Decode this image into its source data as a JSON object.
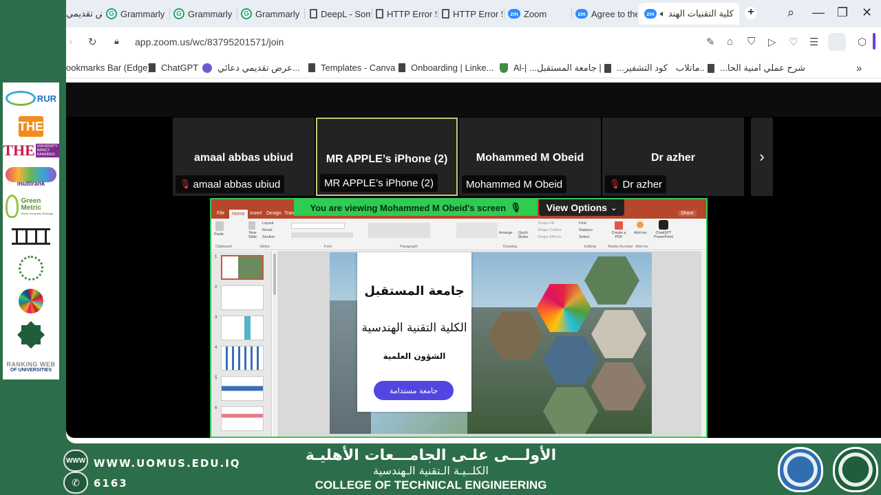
{
  "tabs": [
    {
      "label": "عرض تقديمي",
      "icon": "document-icon"
    },
    {
      "label": "Grammarly",
      "icon": "grammarly-icon"
    },
    {
      "label": "Grammarly",
      "icon": "grammarly-icon"
    },
    {
      "label": "Grammarly",
      "icon": "grammarly-icon"
    },
    {
      "label": "DeepL - Som",
      "icon": "document-icon"
    },
    {
      "label": "HTTP Error 5",
      "icon": "document-icon"
    },
    {
      "label": "HTTP Error 5",
      "icon": "document-icon"
    },
    {
      "label": "Zoom",
      "icon": "zoom-icon"
    },
    {
      "label": "Agree to the",
      "icon": "zoom-icon"
    },
    {
      "label": "كلية التقنيات الهند",
      "icon": "zoom-icon",
      "active": true
    }
  ],
  "address": {
    "url": "app.zoom.us/wc/83795201571/join"
  },
  "bookmarks": [
    "ookmarks Bar (Edge)",
    "ChatGPT",
    "عرض تقديمي دعائي...",
    "Templates - Canva",
    "Onboarding | Linke...",
    "Al-| ...",
    "جامعة المستقبل |",
    "...كود التشفير",
    "ماتلاب..",
    "...شرح عملي امنية الحا"
  ],
  "participants": [
    {
      "name": "amaal abbas ubiud",
      "label": "amaal abbas ubiud",
      "muted": true
    },
    {
      "name": "MR APPLE’s iPhone (2)",
      "label": "MR APPLE’s iPhone (2)",
      "muted": false,
      "active": true
    },
    {
      "name": "Mohammed M Obeid",
      "label": "Mohammed M Obeid",
      "muted": false
    },
    {
      "name": "Dr azher",
      "label": "Dr azher",
      "muted": true
    }
  ],
  "share": {
    "banner": "You are viewing  Mohammed M Obeid's screen",
    "view_options": "View Options"
  },
  "ppt": {
    "tabs": [
      "File",
      "Home",
      "Insert",
      "Design",
      "Trans"
    ],
    "share_label": "Share",
    "groups": [
      "Clipboard",
      "Slides",
      "Font",
      "Paragraph",
      "Drawing",
      "Editing",
      "Adobe Acrobat",
      "Add-ins"
    ],
    "buttons": {
      "paste": "Paste",
      "new_slide": "New Slide",
      "layout": "Layout",
      "reset": "Reset",
      "section": "Section",
      "arrange": "Arrange",
      "quick_styles": "Quick Styles",
      "shape_fill": "Shape Fill",
      "shape_outline": "Shape Outline",
      "shape_effects": "Shape Effects",
      "find": "Find",
      "replace": "Replace",
      "select": "Select",
      "create_pdf": "Create a PDF",
      "addins": "Add-ins",
      "chatgpt": "ChatGPT PowerPoint"
    },
    "thumb_numbers": [
      "1",
      "2",
      "3",
      "4",
      "5",
      "6"
    ],
    "slide": {
      "title": "جامعة المستقبل",
      "subtitle": "الكلية التقنية الهندسية",
      "line3": "الشؤون العلمية",
      "button": "جامعة مستدامة"
    }
  },
  "logos": {
    "rur": "RUR",
    "the": "THE",
    "impact_main": "THE",
    "impact_sub": "UNIVERSITY IMPACT RANKINGS",
    "multirank": "multirank",
    "greenmetric": "Green Metric",
    "greenmetric_sub": "World University Rankings",
    "webometrics_a": "RANKING WEB",
    "webometrics_b": "OF UNIVERSITIES"
  },
  "footer": {
    "website": "WWW.UOMUS.EDU.IQ",
    "phone": "6163",
    "www_icon": "WWW",
    "arabic_line1": "الأولـــى علـى الجامـــعات الأهليـة",
    "arabic_line2": "الكلــيـة الـتقنية الـهندسية",
    "english": "COLLEGE OF TECHNICAL ENGINEERING"
  },
  "colors": {
    "frame_green": "#2c6e49",
    "share_green": "#2ecc52",
    "ppt_red": "#b7472a",
    "zoom_blue": "#2d8cff"
  }
}
